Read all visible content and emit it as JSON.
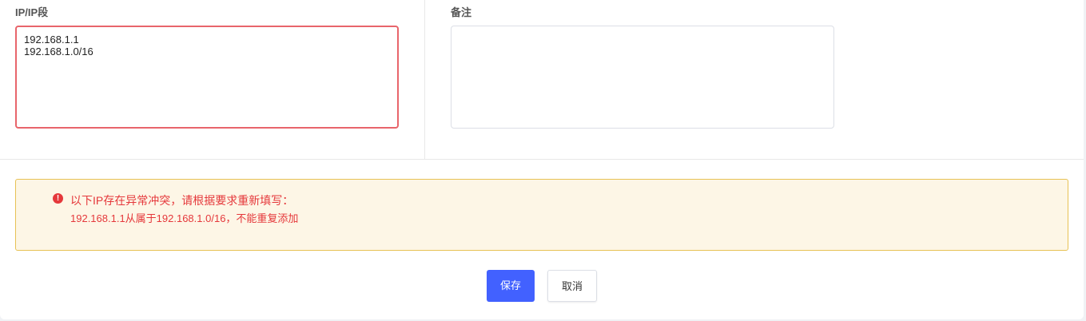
{
  "form": {
    "ip_label": "IP/IP段",
    "ip_value": "192.168.1.1\n192.168.1.0/16",
    "note_label": "备注",
    "note_value": ""
  },
  "alert": {
    "icon": "error-circle-icon",
    "icon_glyph": "!",
    "title": "以下IP存在异常冲突，请根据要求重新填写：",
    "detail": "192.168.1.1从属于192.168.1.0/16，不能重复添加",
    "color": "#e5383b",
    "background": "#fdf6e6"
  },
  "actions": {
    "save_label": "保存",
    "cancel_label": "取消",
    "primary_color": "#4261ff"
  }
}
